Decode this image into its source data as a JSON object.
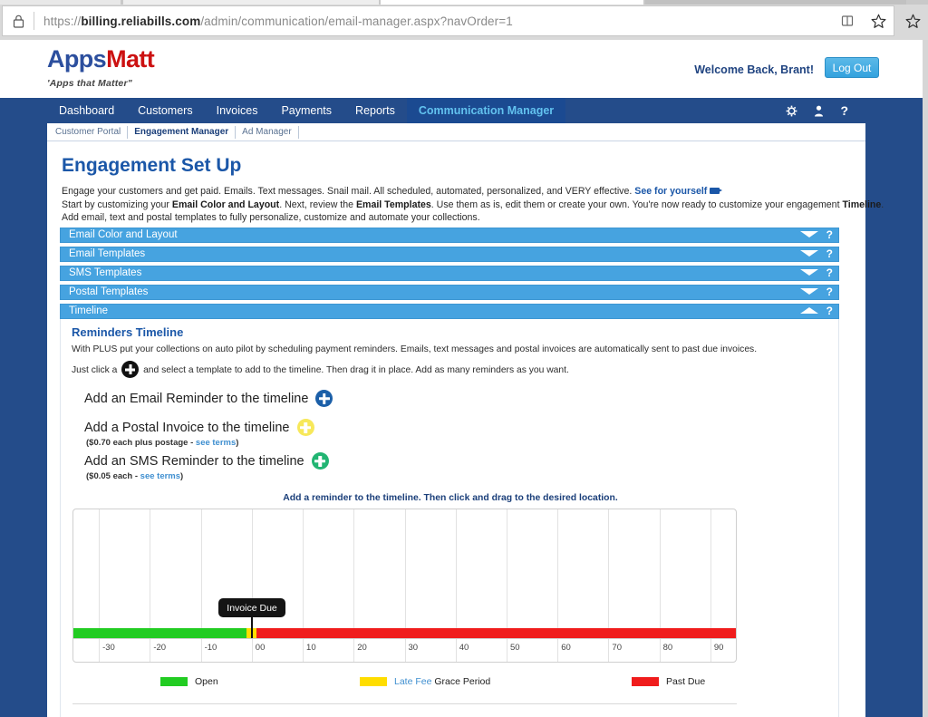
{
  "browser": {
    "url_scheme": "https://",
    "url_domain": "billing.reliabills.com",
    "url_path": "/admin/communication/email-manager.aspx?navOrder=1",
    "lock_icon": "lock-icon",
    "reading_list_icon": "reading-list-icon",
    "favorites_icon": "star-icon",
    "collections_icon": "star-icon"
  },
  "masthead": {
    "logo_first": "Apps",
    "logo_second": "Matt",
    "tagline": "'Apps that Matter\"",
    "welcome": "Welcome Back, Brant!",
    "logout_label": "Log Out"
  },
  "mainnav": {
    "items": [
      {
        "label": "Dashboard",
        "active": false
      },
      {
        "label": "Customers",
        "active": false
      },
      {
        "label": "Invoices",
        "active": false
      },
      {
        "label": "Payments",
        "active": false
      },
      {
        "label": "Reports",
        "active": false
      },
      {
        "label": "Communication Manager",
        "active": true
      }
    ],
    "icons": [
      {
        "name": "gear-icon",
        "glyph": "⚙"
      },
      {
        "name": "user-icon",
        "glyph": "†"
      },
      {
        "name": "help-icon",
        "glyph": "?"
      }
    ]
  },
  "subnav": {
    "items": [
      {
        "label": "Customer Portal",
        "active": false
      },
      {
        "label": "Engagement Manager",
        "active": true
      },
      {
        "label": "Ad Manager",
        "active": false
      }
    ]
  },
  "page": {
    "title": "Engagement Set Up",
    "intro_line1_a": "Engage your customers and get paid. Emails. Text messages. Snail mail. All scheduled, automated, personalized, and VERY effective. ",
    "intro_line1_link": "See for yourself",
    "intro_line2_a": "Start by customizing your ",
    "intro_line2_b": "Email Color and Layout",
    "intro_line2_c": ". Next, review the ",
    "intro_line2_d": "Email Templates",
    "intro_line2_e": ". Use them as is, edit them or create your own. You're now ready to customize your engagement ",
    "intro_line2_f": "Timeline",
    "intro_line2_g": ".",
    "intro_line3": "Add email, text and postal templates to fully personalize, customize and automate your collections."
  },
  "accordion": {
    "help_glyph": "?",
    "sections": [
      {
        "label": "Email Color and Layout",
        "expanded": false
      },
      {
        "label": "Email Templates",
        "expanded": false
      },
      {
        "label": "SMS Templates",
        "expanded": false
      },
      {
        "label": "Postal Templates",
        "expanded": false
      },
      {
        "label": "Timeline",
        "expanded": true
      }
    ]
  },
  "timeline_panel": {
    "heading": "Reminders Timeline",
    "desc_line1": "With PLUS put your collections on auto pilot by scheduling payment reminders. Emails, text messages and postal invoices are automatically sent to past due invoices.",
    "desc_line2_a": "Just click a ",
    "desc_line2_b": " and select a template to add to the timeline. Then drag it in place. Add as many reminders as you want.",
    "add_email_label": "Add an Email Reminder to the timeline",
    "add_postal_label": "Add a Postal Invoice to the timeline",
    "add_sms_label": "Add an SMS Reminder to the timeline",
    "postal_terms_prefix": "($0.70 each plus postage - ",
    "postal_terms_link": "see terms",
    "postal_terms_suffix": ")",
    "sms_terms_prefix": "($0.05 each - ",
    "sms_terms_link": "see terms",
    "sms_terms_suffix": ")",
    "chart_hint": "Add a reminder to the timeline. Then click and drag to the desired location.",
    "email_plus_color": "#1b5fa8",
    "postal_plus_color": "#f7e85a",
    "sms_plus_color": "#22b573"
  },
  "legend": {
    "open_label": "Open",
    "grace_link": "Late Fee",
    "grace_label": " Grace Period",
    "past_due_label": "Past Due",
    "open_color": "#22cc22",
    "grace_color": "#ffdd00",
    "past_due_color": "#f01c1c"
  },
  "chart_data": {
    "type": "bar",
    "title": "Reminders Timeline",
    "xlabel": "",
    "ylabel": "",
    "xlim": [
      -35,
      95
    ],
    "tick_labels": [
      "-30",
      "-20",
      "-10",
      "00",
      "10",
      "20",
      "30",
      "40",
      "50",
      "60",
      "70",
      "80",
      "90"
    ],
    "tick_values": [
      -30,
      -20,
      -10,
      0,
      10,
      20,
      30,
      40,
      50,
      60,
      70,
      80,
      90
    ],
    "grid": true,
    "legend_position": "bottom",
    "annotations": [
      {
        "label": "Invoice Due",
        "x": 0
      }
    ],
    "series": [
      {
        "name": "Open",
        "color": "#22cc22",
        "start": -35,
        "end": -1
      },
      {
        "name": "Late Fee Grace Period",
        "color": "#ffdd00",
        "start": -1,
        "end": 1
      },
      {
        "name": "Past Due",
        "color": "#f01c1c",
        "start": 1,
        "end": 95
      }
    ],
    "reminders": []
  }
}
